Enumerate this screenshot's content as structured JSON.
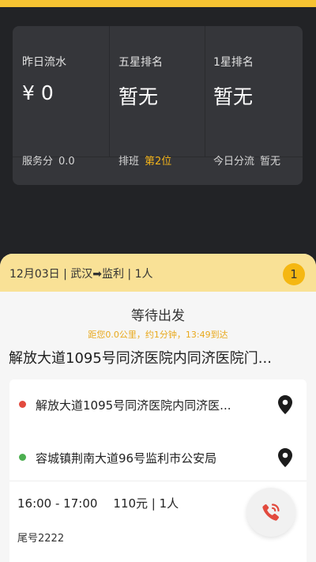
{
  "colors": {
    "accent_yellow": "#f6c332",
    "badge_yellow": "#f5b712",
    "highlight_gold": "#f4b41a",
    "start_dot": "#e24a3e",
    "end_dot": "#4caf50",
    "call_red": "#e24a3e"
  },
  "stats": {
    "yesterday_flow": {
      "label": "昨日流水",
      "value": "¥ 0"
    },
    "five_star": {
      "label": "五星排名",
      "value": "暂无"
    },
    "one_star": {
      "label": "1星排名",
      "value": "暂无"
    },
    "service_score": {
      "label": "服务分",
      "value": "0.0"
    },
    "schedule": {
      "label": "排班",
      "value": "第2位"
    },
    "today_flow": {
      "label": "今日分流",
      "value": "暂无"
    }
  },
  "order": {
    "header": "12月03日 | 武汉➡监利 | 1人",
    "badge": "1",
    "status": "等待出发",
    "eta": "距您0.0公里，约1分钟，13:49到达",
    "title_address": "解放大道1095号同济医院内同济医院门...",
    "pickup": "解放大道1095号同济医院内同济医...",
    "dropoff": "容城镇荆南大道96号监利市公安局",
    "time_range": "16:00 - 17:00",
    "fare": "110元 | 1人",
    "tail_number": "尾号2222",
    "icons": {
      "pickup_pin": "map-pin-icon",
      "dropoff_pin": "map-pin-icon",
      "call": "phone-call-icon"
    }
  }
}
